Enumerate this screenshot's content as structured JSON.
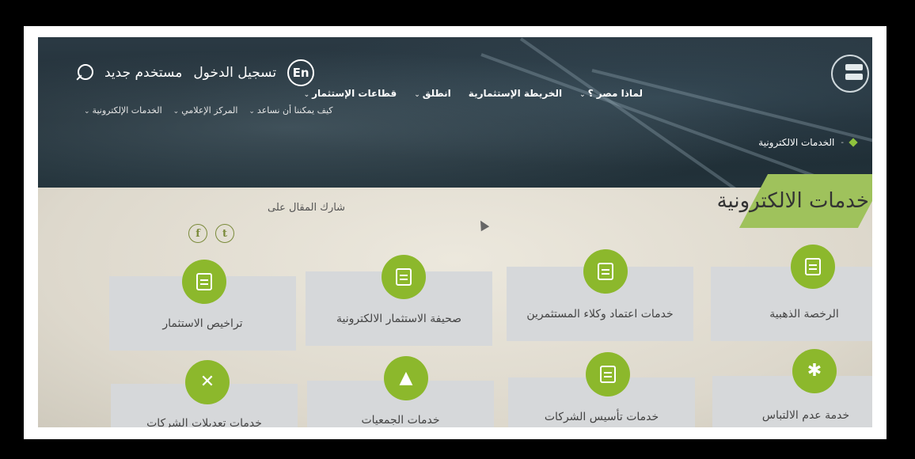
{
  "header": {
    "lang_button": "En",
    "login": "تسجيل الدخول",
    "new_user": "مستخدم جديد",
    "main_nav": [
      "لماذا مصر ؟",
      "الخريطة الإستثمارية",
      "انطلق",
      "قطاعات الإستثمار",
      "كيف يمكننا أن نساعد",
      "المركز الإعلامي",
      "الخدمات الإلكترونية"
    ],
    "breadcrumb": "الخدمات الالكترونية"
  },
  "page": {
    "title": "خدمات الالكترونية",
    "share_label": "شارك المقال على",
    "social": [
      "f",
      "t"
    ]
  },
  "services": [
    {
      "label": "الرخصة الذهبية",
      "icon": "license-icon"
    },
    {
      "label": "خدمات اعتماد وكلاء المستثمرين",
      "icon": "clipboard-icon"
    },
    {
      "label": "صحيفة الاستثمار الالكترونية",
      "icon": "document-icon"
    },
    {
      "label": "تراخيص الاستثمار",
      "icon": "certificate-icon"
    },
    {
      "label": "خدمة عدم الالتباس",
      "icon": "group-icon"
    },
    {
      "label": "خدمات تأسيس الشركات",
      "icon": "clipboard-icon"
    },
    {
      "label": "خدمات الجمعيات",
      "icon": "building-icon"
    },
    {
      "label": "خدمات تعديلات الشركات",
      "icon": "tools-icon"
    }
  ],
  "colors": {
    "accent": "#8cb82c",
    "title_bar": "#9fc25c",
    "card": "#d6d8da"
  }
}
